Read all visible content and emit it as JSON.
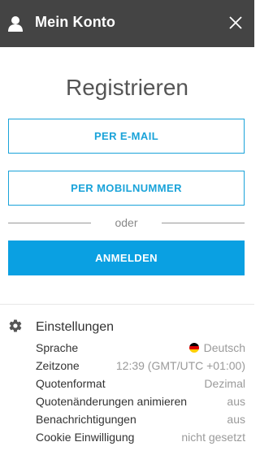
{
  "header": {
    "title": "Mein Konto"
  },
  "register": {
    "title": "Registrieren",
    "email_button": "PER E-MAIL",
    "mobile_button": "PER MOBILNUMMER",
    "or_text": "oder",
    "login_button": "ANMELDEN"
  },
  "settings": {
    "title": "Einstellungen",
    "items": [
      {
        "label": "Sprache",
        "value": "Deutsch",
        "flag": "de"
      },
      {
        "label": "Zeitzone",
        "value": "12:39 (GMT/UTC +01:00)"
      },
      {
        "label": "Quotenformat",
        "value": "Dezimal"
      },
      {
        "label": "Quotenänderungen animieren",
        "value": "aus"
      },
      {
        "label": "Benachrichtigungen",
        "value": "aus"
      },
      {
        "label": "Cookie Einwilligung",
        "value": "nicht gesetzt"
      }
    ]
  },
  "colors": {
    "header_bg": "#444444",
    "accent": "#0aa0e2"
  }
}
